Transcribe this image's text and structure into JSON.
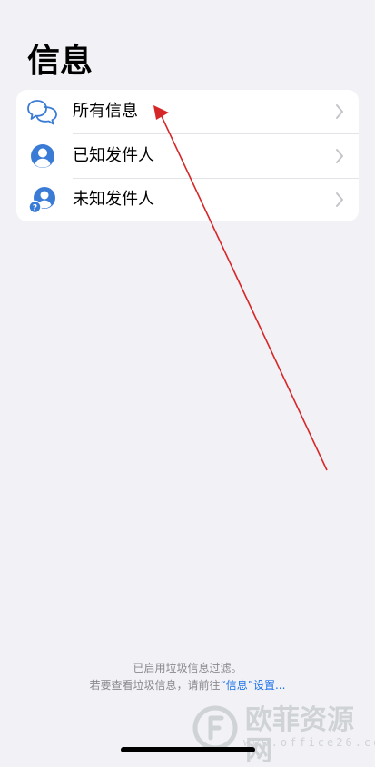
{
  "header": {
    "title": "信息"
  },
  "filter_list": {
    "items": [
      {
        "label": "所有信息",
        "icon": "chat-bubbles-icon"
      },
      {
        "label": "已知发件人",
        "icon": "person-circle-icon"
      },
      {
        "label": "未知发件人",
        "icon": "unknown-person-icon"
      }
    ]
  },
  "footer": {
    "line1": "已启用垃圾信息过滤。",
    "line2_prefix": "若要查看垃圾信息，请前往",
    "line2_link": "“信息”设置...",
    "link_color": "#1a73e8"
  },
  "watermark": {
    "text": "欧菲资源网",
    "subtext": "www.office26.com"
  },
  "colors": {
    "background": "#f2f1f6",
    "card": "#ffffff",
    "icon_blue": "#3a7bd5",
    "annotation_arrow": "#d62728"
  }
}
